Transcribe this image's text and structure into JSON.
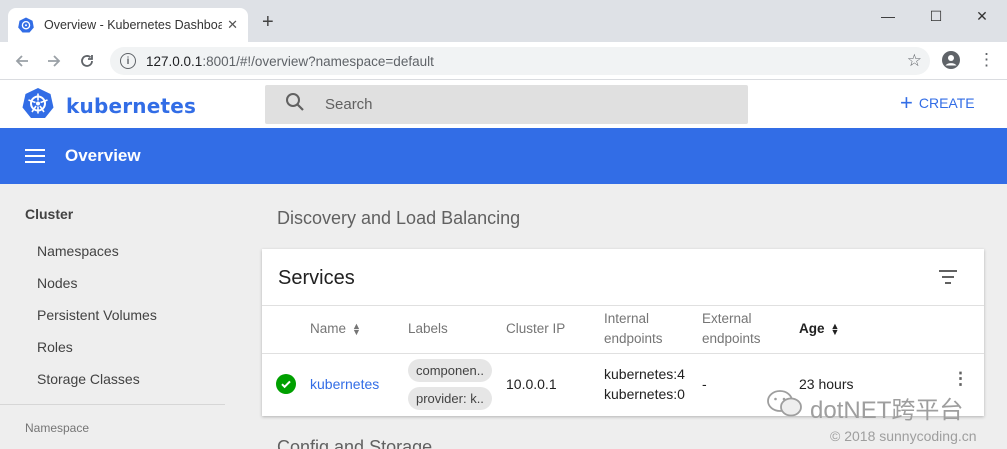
{
  "browser": {
    "tab_title": "Overview - Kubernetes Dashboard",
    "tab_close": "✕",
    "new_tab": "+",
    "url_host": "127.0.0.1",
    "url_path": ":8001/#!/overview?namespace=default",
    "window_controls": {
      "minimize": "—",
      "maximize": "☐",
      "close": "✕"
    }
  },
  "header": {
    "logo_text": "kubernetes",
    "search_placeholder": "Search",
    "create_label": "CREATE",
    "create_icon": "+"
  },
  "titlebar": {
    "title": "Overview"
  },
  "sidebar": {
    "section": "Cluster",
    "items": [
      "Namespaces",
      "Nodes",
      "Persistent Volumes",
      "Roles",
      "Storage Classes"
    ],
    "namespace_label": "Namespace"
  },
  "main": {
    "section_title": "Discovery and Load Balancing",
    "next_section_title": "Config and Storage",
    "services": {
      "title": "Services",
      "columns": {
        "name": "Name",
        "labels": "Labels",
        "cluster_ip": "Cluster IP",
        "internal_1": "Internal",
        "internal_2": "endpoints",
        "external_1": "External",
        "external_2": "endpoints",
        "age": "Age"
      },
      "rows": [
        {
          "status": "ok",
          "name": "kubernetes",
          "labels": [
            "componen..",
            "provider: k.."
          ],
          "cluster_ip": "10.0.0.1",
          "internal_endpoints": [
            "kubernetes:4",
            "kubernetes:0"
          ],
          "external_endpoints": "-",
          "age": "23 hours",
          "menu": "⋮"
        }
      ]
    }
  },
  "watermark": {
    "brand": "dotNET跨平台",
    "copyright": "© 2018 sunnycoding.cn"
  },
  "colors": {
    "accent": "#326de6",
    "success": "#00a000"
  }
}
